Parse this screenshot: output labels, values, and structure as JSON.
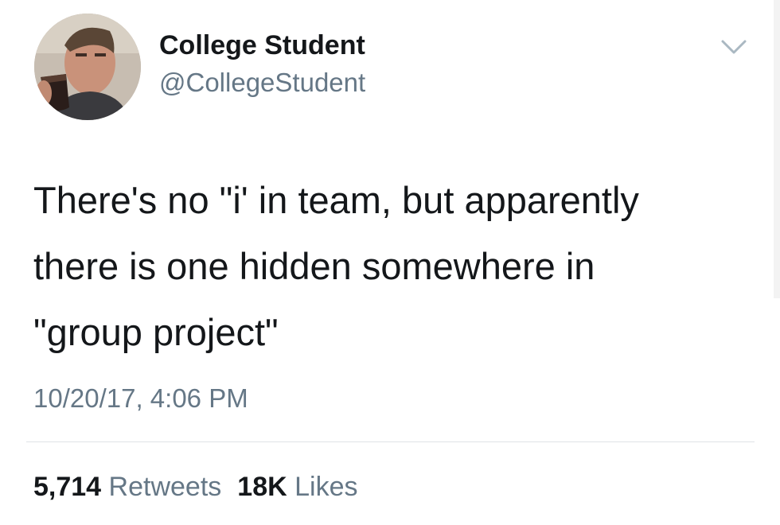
{
  "tweet": {
    "author_name": "College Student",
    "author_handle": "@CollegeStudent",
    "text": "There's no \"i' in team, but apparently\nthere is one hidden somewhere in\n\"group project\"",
    "timestamp": "10/20/17, 4:06 PM"
  },
  "stats": {
    "retweets_count": "5,714",
    "retweets_label": "Retweets",
    "likes_count": "18K",
    "likes_label": "Likes"
  },
  "icons": {
    "menu": "chevron-down-icon",
    "avatar": "avatar"
  },
  "colors": {
    "text": "#14171a",
    "secondary": "#657786",
    "divider": "#dfe3e6",
    "background": "#ffffff"
  }
}
